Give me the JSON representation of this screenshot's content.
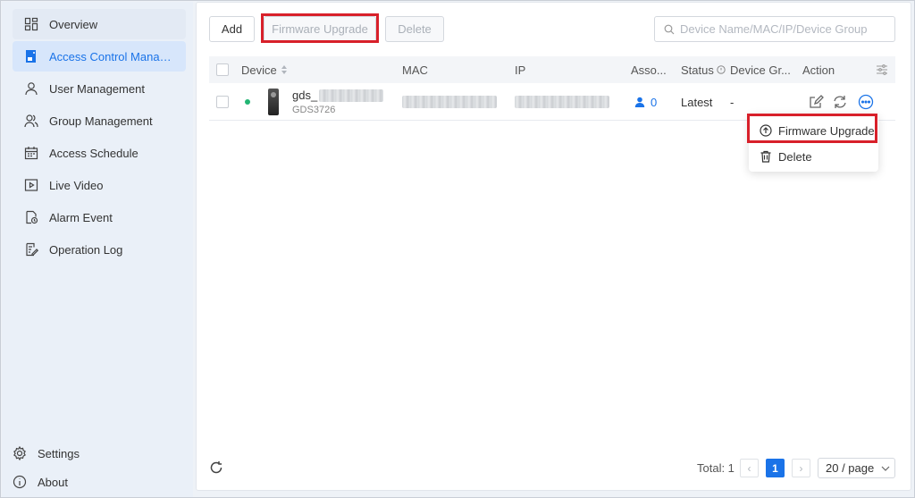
{
  "sidebar": {
    "items": [
      {
        "label": "Overview",
        "icon": "dashboard-grid-icon"
      },
      {
        "label": "Access Control Manag...",
        "icon": "access-control-icon"
      },
      {
        "label": "User Management",
        "icon": "user-icon"
      },
      {
        "label": "Group Management",
        "icon": "group-icon"
      },
      {
        "label": "Access Schedule",
        "icon": "calendar-icon"
      },
      {
        "label": "Live Video",
        "icon": "video-icon"
      },
      {
        "label": "Alarm Event",
        "icon": "alarm-event-icon"
      },
      {
        "label": "Operation Log",
        "icon": "log-icon"
      }
    ],
    "bottom": [
      {
        "label": "Settings",
        "icon": "gear-icon"
      },
      {
        "label": "About",
        "icon": "info-icon"
      }
    ]
  },
  "toolbar": {
    "add_label": "Add",
    "firmware_upgrade_label": "Firmware Upgrade",
    "delete_label": "Delete"
  },
  "search": {
    "placeholder": "Device Name/MAC/IP/Device Group"
  },
  "table": {
    "columns": [
      "Device",
      "MAC",
      "IP",
      "Asso...",
      "Status",
      "Device Gr...",
      "Action"
    ],
    "rows": [
      {
        "name": "gds_",
        "model": "GDS3726",
        "associated_users": "0",
        "status": "Latest",
        "device_group": "-"
      }
    ]
  },
  "dropdown_menu": {
    "items": [
      {
        "label": "Firmware Upgrade",
        "icon": "upload-icon"
      },
      {
        "label": "Delete",
        "icon": "trash-icon"
      }
    ]
  },
  "pagination": {
    "total_label": "Total: 1",
    "current_page": "1",
    "page_size": "20 / page"
  },
  "colors": {
    "accent": "#1a73e8",
    "online": "#22b573",
    "highlight": "#d8202a"
  }
}
